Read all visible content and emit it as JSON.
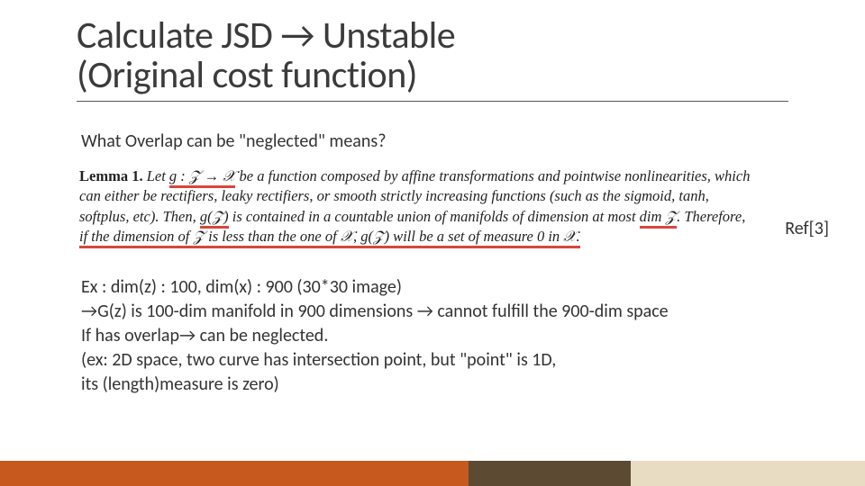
{
  "title": {
    "line1_a": "Calculate JSD ",
    "line1_arrow": "→",
    "line1_b": " Unstable",
    "line2": "(Original cost function)"
  },
  "subhead": "What Overlap can be \"neglected\" means?",
  "lemma": {
    "label": "Lemma 1.",
    "t1": " Let ",
    "g_map": "g : 𝒵 → 𝒳",
    "t2": " be a function composed by affine transformations and pointwise nonlinearities, which can either be rectifiers, leaky rectifiers, or smooth strictly increasing functions (such as the sigmoid, tanh, softplus, etc). Then, ",
    "gz": "g(𝒵)",
    "t3": " is contained in a countable union of manifolds of dimension at most ",
    "dimz": "dim 𝒵",
    "t4": ". Therefore, ",
    "cond": "if the dimension of 𝒵 is less than the one of 𝒳, g(𝒵) will be a set of measure 0 in 𝒳.",
    "tail": ""
  },
  "ref": "Ref[3]",
  "example": {
    "l1": "Ex : dim(z) : 100, dim(x) : 900 (30*30 image)",
    "l2": "→G(z) is 100-dim manifold in 900 dimensions → cannot fulfill the 900-dim space",
    "l3": "If has overlap→ can be neglected.",
    "l4": "(ex: 2D space, two curve has intersection point, but \"point\" is 1D,",
    "l5": "its (length)measure is zero)"
  }
}
